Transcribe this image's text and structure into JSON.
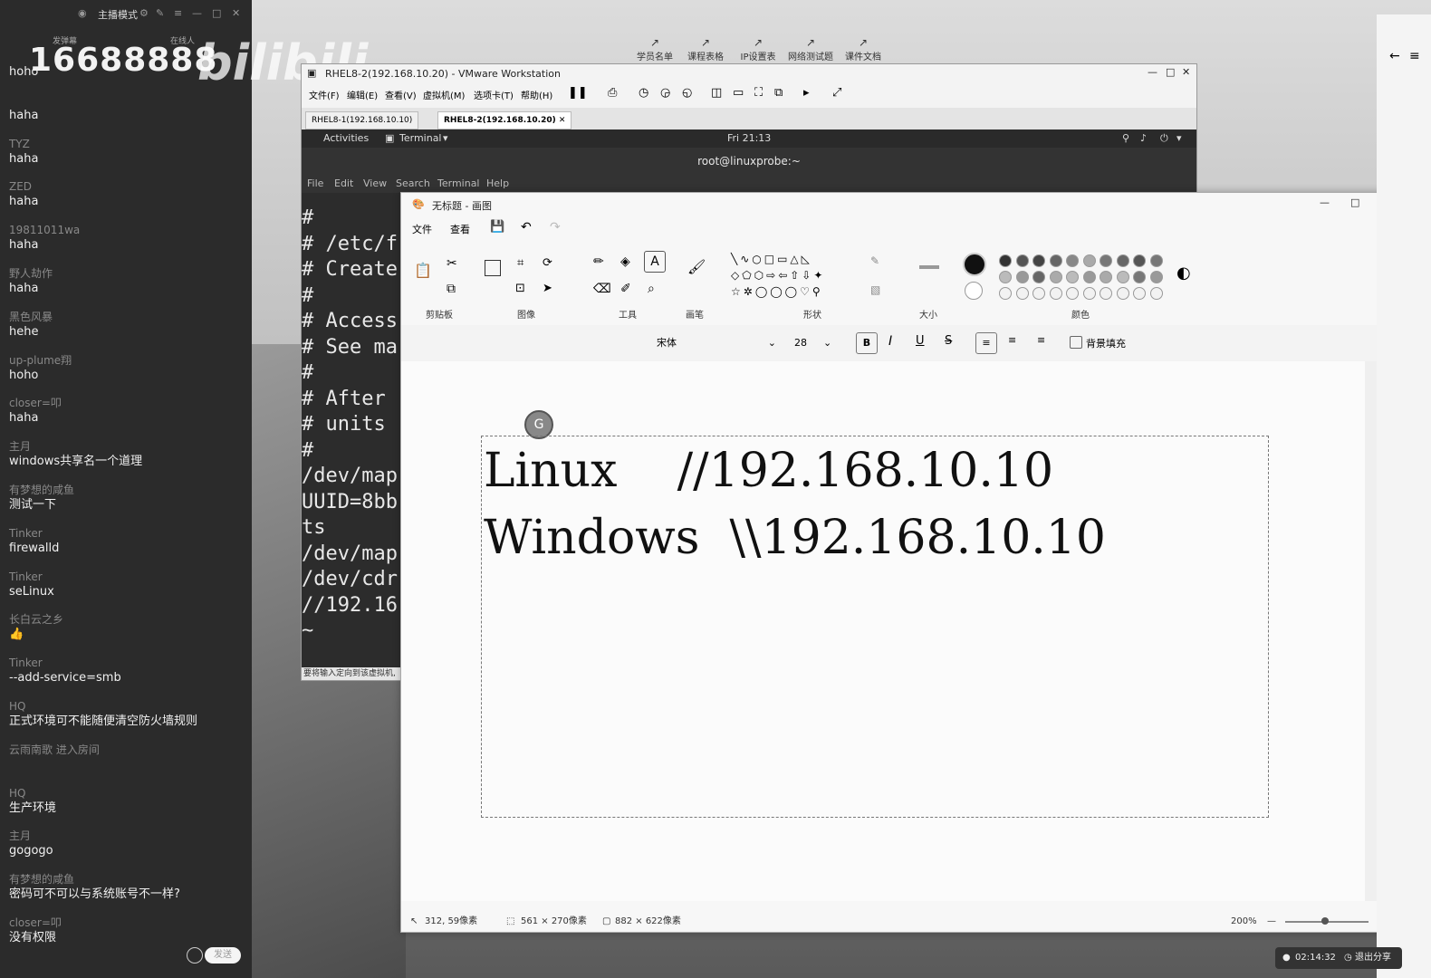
{
  "chat": {
    "mode": "主播模式",
    "room_number": "16688888",
    "logo": "bilibili",
    "header_left": "发弹幕",
    "header_right": "在线人",
    "messages": [
      {
        "user": "",
        "text": "hoho"
      },
      {
        "user": "",
        "text": "haha"
      },
      {
        "user": "TYZ",
        "text": "haha"
      },
      {
        "user": "ZED",
        "text": "haha"
      },
      {
        "user": "19811011wa",
        "text": "haha"
      },
      {
        "user": "野人劫作",
        "text": "haha"
      },
      {
        "user": "黑色风暴",
        "text": "hehe"
      },
      {
        "user": "up-plume翔",
        "text": "hoho"
      },
      {
        "user": "closer=叩",
        "text": "haha"
      },
      {
        "user": "主月",
        "text": "windows共享名一个道理"
      },
      {
        "user": "有梦想的咸鱼",
        "text": "测试一下"
      },
      {
        "user": "Tinker",
        "text": "firewalld"
      },
      {
        "user": "Tinker",
        "text": "seLinux"
      },
      {
        "user": "长白云之乡",
        "text": "👍"
      },
      {
        "user": "Tinker",
        "text": "--add-service=smb"
      },
      {
        "user": "HQ",
        "text": "正式环境可不能随便清空防火墙规则"
      },
      {
        "user": "云雨南歌 进入房间",
        "text": ""
      },
      {
        "user": "HQ",
        "text": "生产环境"
      },
      {
        "user": "主月",
        "text": "gogogo"
      },
      {
        "user": "有梦想的咸鱼",
        "text": "密码可不可以与系统账号不一样?"
      },
      {
        "user": "closer=叩",
        "text": "没有权限"
      }
    ],
    "send_label": "发送"
  },
  "shortcuts": [
    "学员名单",
    "课程表格",
    "IP设置表",
    "网络测试题",
    "课件文档"
  ],
  "vmware": {
    "title": "RHEL8-2(192.168.10.20) - VMware Workstation",
    "menu": [
      "文件(F)",
      "编辑(E)",
      "查看(V)",
      "虚拟机(M)",
      "选项卡(T)",
      "帮助(H)"
    ],
    "tabs": [
      "RHEL8-1(192.168.10.10)",
      "RHEL8-2(192.168.10.20)"
    ],
    "status": "要将输入定向到该虚拟机,"
  },
  "gnome": {
    "activities": "Activities",
    "app": "Terminal",
    "clock": "Fri 21:13"
  },
  "terminal": {
    "title": "root@linuxprobe:~",
    "menu": [
      "File",
      "Edit",
      "View",
      "Search",
      "Terminal",
      "Help"
    ],
    "lines": [
      "#",
      "# /etc/f",
      "# Create",
      "#",
      "# Access",
      "# See ma",
      "#",
      "# After",
      "# units",
      "#",
      "/dev/map",
      "UUID=8bb",
      "ts",
      "/dev/map",
      "/dev/cdr",
      "//192.16",
      "~"
    ]
  },
  "paint": {
    "title": "无标题 - 画图",
    "menu": [
      "文件",
      "查看"
    ],
    "groups": [
      "剪贴板",
      "图像",
      "工具",
      "画笔",
      "形状",
      "大小",
      "颜色"
    ],
    "font_name": "宋体",
    "font_size": "28",
    "bg_fill": "背景填充",
    "canvas_lines": [
      "Linux    //192.168.10.10",
      "Windows  \\\\192.168.10.10"
    ],
    "status": {
      "cursor": "312, 59像素",
      "selection": "561 × 270像素",
      "canvas_size": "882 × 622像素",
      "zoom": "200%"
    }
  },
  "tray": {
    "timer": "02:14:32",
    "exit_share": "退出分享"
  },
  "colors": {
    "chat_bg": "#2b2b2b",
    "terminal_bg": "#2c2c2c",
    "paint_bg": "#fbfbfb"
  }
}
